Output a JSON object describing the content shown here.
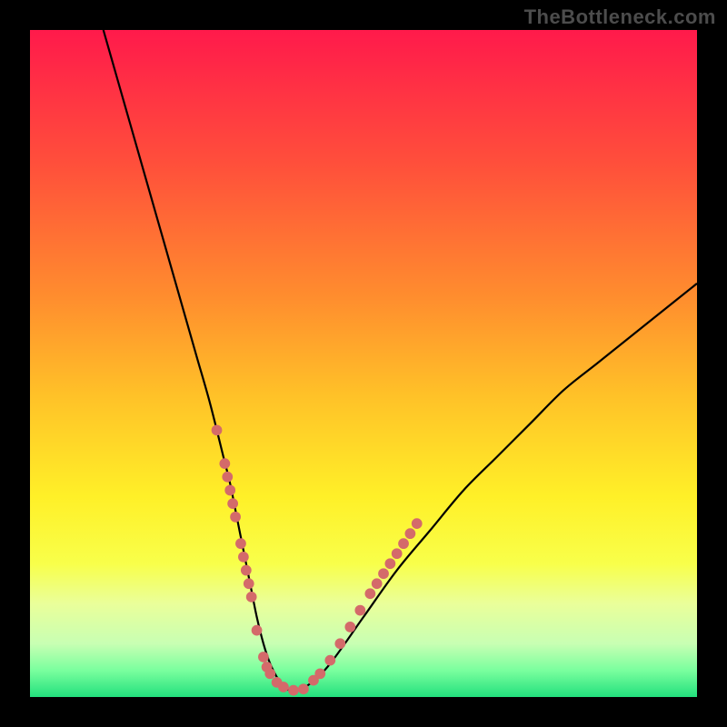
{
  "attribution": "TheBottleneck.com",
  "chart_data": {
    "type": "line",
    "title": "",
    "xlabel": "",
    "ylabel": "",
    "xlim": [
      0,
      100
    ],
    "ylim": [
      0,
      100
    ],
    "background": {
      "type": "vertical-gradient",
      "stops": [
        {
          "pos": 0.0,
          "color": "#ff1a4b"
        },
        {
          "pos": 0.2,
          "color": "#ff4f3b"
        },
        {
          "pos": 0.4,
          "color": "#ff8d2e"
        },
        {
          "pos": 0.55,
          "color": "#ffc228"
        },
        {
          "pos": 0.7,
          "color": "#fff028"
        },
        {
          "pos": 0.8,
          "color": "#f8ff4a"
        },
        {
          "pos": 0.86,
          "color": "#eaff9a"
        },
        {
          "pos": 0.92,
          "color": "#c8ffb3"
        },
        {
          "pos": 0.96,
          "color": "#7aff9e"
        },
        {
          "pos": 1.0,
          "color": "#22e07d"
        }
      ]
    },
    "series": [
      {
        "name": "bottleneck-curve",
        "color": "#000000",
        "width": 2,
        "x": [
          11,
          13,
          15,
          17,
          19,
          21,
          23,
          25,
          27,
          29,
          30,
          31,
          32,
          33,
          34,
          35,
          36,
          37,
          38,
          39,
          40,
          42,
          45,
          50,
          55,
          60,
          65,
          70,
          75,
          80,
          85,
          90,
          95,
          100
        ],
        "y": [
          100,
          93,
          86,
          79,
          72,
          65,
          58,
          51,
          44,
          36,
          32,
          27,
          22,
          17,
          12,
          8,
          5,
          3,
          1.5,
          1,
          1,
          2,
          5,
          12,
          19,
          25,
          31,
          36,
          41,
          46,
          50,
          54,
          58,
          62
        ]
      }
    ],
    "highlight_points": {
      "name": "dot-markers",
      "color": "#d46a6a",
      "radius": 5,
      "points": [
        {
          "x": 28.0,
          "y": 40
        },
        {
          "x": 29.2,
          "y": 35
        },
        {
          "x": 29.6,
          "y": 33
        },
        {
          "x": 30.0,
          "y": 31
        },
        {
          "x": 30.4,
          "y": 29
        },
        {
          "x": 30.8,
          "y": 27
        },
        {
          "x": 31.6,
          "y": 23
        },
        {
          "x": 32.0,
          "y": 21
        },
        {
          "x": 32.4,
          "y": 19
        },
        {
          "x": 32.8,
          "y": 17
        },
        {
          "x": 33.2,
          "y": 15
        },
        {
          "x": 34.0,
          "y": 10
        },
        {
          "x": 35.0,
          "y": 6
        },
        {
          "x": 35.5,
          "y": 4.5
        },
        {
          "x": 36.0,
          "y": 3.5
        },
        {
          "x": 37.0,
          "y": 2.2
        },
        {
          "x": 38.0,
          "y": 1.5
        },
        {
          "x": 39.5,
          "y": 1.0
        },
        {
          "x": 41.0,
          "y": 1.2
        },
        {
          "x": 42.5,
          "y": 2.5
        },
        {
          "x": 43.5,
          "y": 3.5
        },
        {
          "x": 45.0,
          "y": 5.5
        },
        {
          "x": 46.5,
          "y": 8.0
        },
        {
          "x": 48.0,
          "y": 10.5
        },
        {
          "x": 49.5,
          "y": 13.0
        },
        {
          "x": 51.0,
          "y": 15.5
        },
        {
          "x": 52.0,
          "y": 17.0
        },
        {
          "x": 53.0,
          "y": 18.5
        },
        {
          "x": 54.0,
          "y": 20.0
        },
        {
          "x": 55.0,
          "y": 21.5
        },
        {
          "x": 56.0,
          "y": 23.0
        },
        {
          "x": 57.0,
          "y": 24.5
        },
        {
          "x": 58.0,
          "y": 26.0
        }
      ]
    }
  }
}
